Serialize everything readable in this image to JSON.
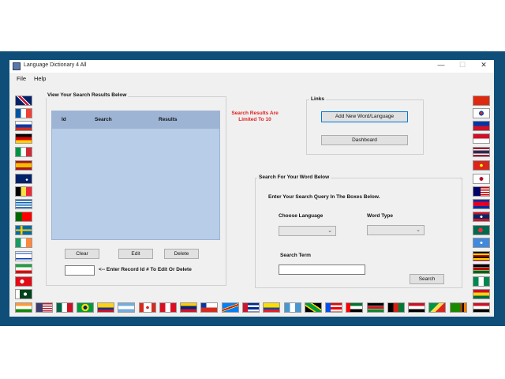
{
  "window": {
    "title": "Language Dictionary 4 All",
    "minimize": "—",
    "maximize": "☐",
    "close": "✕"
  },
  "menu": {
    "file": "File",
    "help": "Help"
  },
  "results_group": {
    "label": "View Your Search Results Below",
    "columns": [
      "Id",
      "Search",
      "Results"
    ],
    "clear": "Clear",
    "edit": "Edit",
    "delete": "Delete",
    "record_hint": "<-- Enter Record Id # To Edit Or Delete",
    "record_value": ""
  },
  "limit_notice": {
    "line1": "Search Results Are",
    "line2": "Limited To 10"
  },
  "links_group": {
    "label": "Links",
    "add_new": "Add New Word/Language",
    "dashboard": "Dashboard"
  },
  "search_group": {
    "label": "Search For Your Word Below",
    "instructions": "Enter Your Search Query In The Boxes Below.",
    "choose_language_label": "Choose Language",
    "word_type_label": "Word Type",
    "choose_language_value": "",
    "word_type_value": "",
    "search_term_label": "Search Term",
    "search_term_value": "",
    "search_button": "Search"
  },
  "flags": {
    "left": [
      "uk",
      "france",
      "russia",
      "germany",
      "italy",
      "spain",
      "australia",
      "belgium",
      "greece",
      "portugal",
      "sweden",
      "ireland",
      "israel",
      "iran",
      "turkey",
      "pakistan"
    ],
    "right": [
      "china",
      "south-korea",
      "philippines",
      "indonesia",
      "thailand",
      "vietnam",
      "japan",
      "malaysia",
      "cambodia",
      "laos",
      "bangladesh",
      "somalia",
      "uganda",
      "kenya",
      "nigeria",
      "ghana"
    ],
    "bottom": [
      "india",
      "usa",
      "mexico",
      "brazil",
      "colombia",
      "argentina",
      "canada",
      "peru",
      "venezuela",
      "chile",
      "dr-congo",
      "cuba",
      "ecuador",
      "guatemala",
      "jamaica",
      "puerto-rico",
      "uae",
      "south-sudan",
      "afghanistan",
      "egypt",
      "congo",
      "zambia",
      "yemen"
    ]
  },
  "colors": {
    "frame": "#0f4e78",
    "grid": "#b7cde8",
    "grid_header": "#9db4d4",
    "notice": "#e02020"
  }
}
